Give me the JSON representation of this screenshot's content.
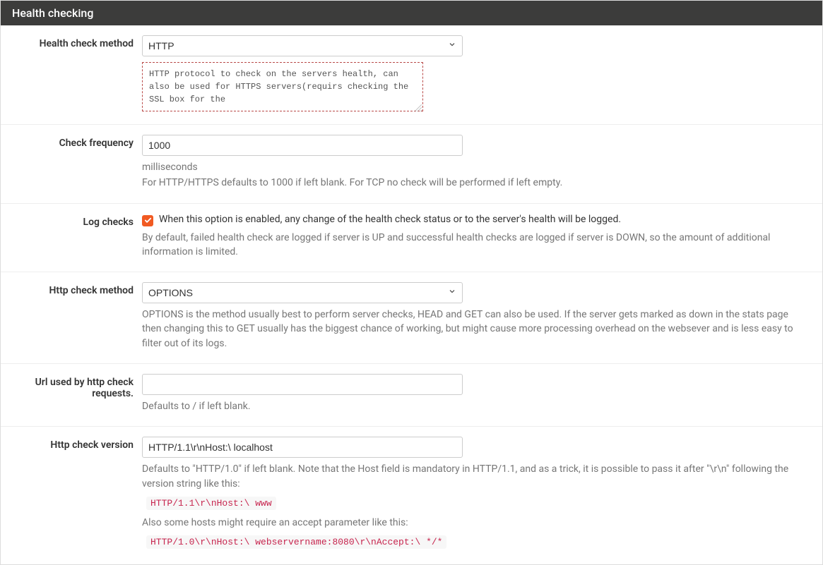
{
  "panel": {
    "title": "Health checking"
  },
  "rows": {
    "method": {
      "label": "Health check method",
      "value": "HTTP",
      "desc": "HTTP protocol to check on the servers health, can also be used for HTTPS servers(requirs checking the SSL box for the"
    },
    "freq": {
      "label": "Check frequency",
      "value": "1000",
      "unit": "milliseconds",
      "hint": "For HTTP/HTTPS defaults to 1000 if left blank. For TCP no check will be performed if left empty."
    },
    "log": {
      "label": "Log checks",
      "chk_label": "When this option is enabled, any change of the health check status or to the server's health will be logged.",
      "hint": "By default, failed health check are logged if server is UP and successful health checks are logged if server is DOWN, so the amount of additional information is limited."
    },
    "httpmethod": {
      "label": "Http check method",
      "value": "OPTIONS",
      "hint": "OPTIONS is the method usually best to perform server checks, HEAD and GET can also be used. If the server gets marked as down in the stats page then changing this to GET usually has the biggest chance of working, but might cause more processing overhead on the websever and is less easy to filter out of its logs."
    },
    "url": {
      "label": "Url used by http check requests.",
      "value": "",
      "hint": "Defaults to / if left blank."
    },
    "version": {
      "label": "Http check version",
      "value": "HTTP/1.1\\r\\nHost:\\ localhost",
      "hint1": "Defaults to \"HTTP/1.0\" if left blank. Note that the Host field is mandatory in HTTP/1.1, and as a trick, it is possible to pass it after \"\\r\\n\" following the version string like this:",
      "code1": "HTTP/1.1\\r\\nHost:\\ www",
      "hint2": "Also some hosts might require an accept parameter like this:",
      "code2": "HTTP/1.0\\r\\nHost:\\ webservername:8080\\r\\nAccept:\\ */*"
    }
  }
}
